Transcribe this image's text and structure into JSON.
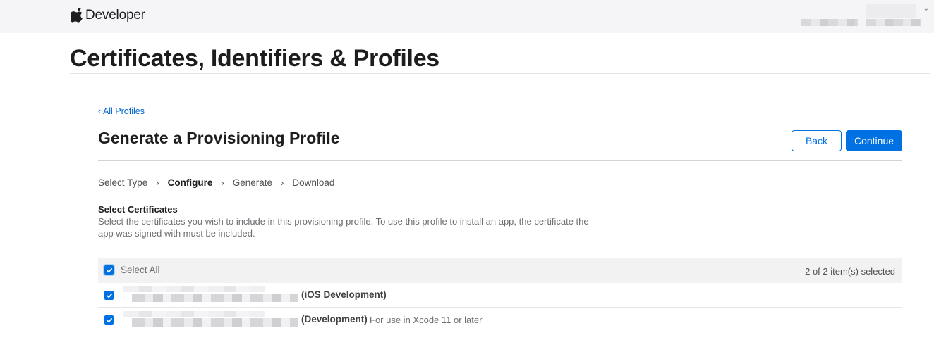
{
  "nav": {
    "brand_label": "Developer"
  },
  "page": {
    "title": "Certificates, Identifiers & Profiles"
  },
  "content": {
    "back_link": "‹ All Profiles",
    "title": "Generate a Provisioning Profile",
    "back_button": "Back",
    "continue_button": "Continue"
  },
  "steps": [
    {
      "label": "Select Type",
      "active": false
    },
    {
      "label": "Configure",
      "active": true
    },
    {
      "label": "Generate",
      "active": false
    },
    {
      "label": "Download",
      "active": false
    }
  ],
  "certificates": {
    "heading": "Select Certificates",
    "description": "Select the certificates you wish to include in this provisioning profile. To use this profile to install an app, the certificate the app was signed with must be included.",
    "select_all_label": "Select All",
    "selected_count": "2 of 2 item(s) selected",
    "rows": [
      {
        "type": "(iOS Development)",
        "note": "",
        "checked": true
      },
      {
        "type": "(Development)",
        "note": "For use in Xcode 11 or later",
        "checked": true
      }
    ]
  },
  "colors": {
    "accent": "#0071e3",
    "link": "#0066cc",
    "nav_bg": "#f5f5f7",
    "table_header_bg": "#f2f2f2"
  }
}
